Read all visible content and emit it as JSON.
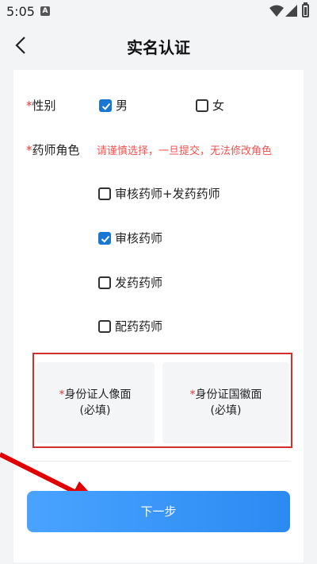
{
  "status_bar": {
    "time": "5:05",
    "sim_icon": "A"
  },
  "header": {
    "title": "实名认证"
  },
  "form": {
    "required_mark": "*",
    "gender": {
      "label": "性别",
      "options": [
        {
          "label": "男",
          "checked": true
        },
        {
          "label": "女",
          "checked": false
        }
      ]
    },
    "role": {
      "label": "药师角色",
      "warning": "请谨慎选择，一旦提交，无法修改角色",
      "options": [
        {
          "label": "审核药师+发药药师",
          "checked": false
        },
        {
          "label": "审核药师",
          "checked": true
        },
        {
          "label": "发药药师",
          "checked": false
        },
        {
          "label": "配药药师",
          "checked": false
        }
      ]
    },
    "id_front": {
      "label": "身份证人像面",
      "hint": "(必填)"
    },
    "id_back": {
      "label": "身份证国徽面",
      "hint": "(必填)"
    }
  },
  "next_button": {
    "label": "下一步"
  },
  "colors": {
    "accent": "#2b8af2",
    "required": "#e53935",
    "highlight_box": "#d32f2f"
  }
}
